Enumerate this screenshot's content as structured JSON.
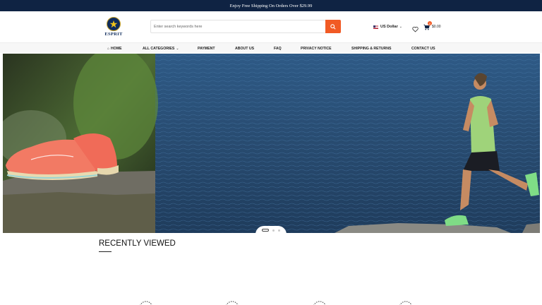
{
  "announcement": "Enjoy Free Shipping On Orders Over $29.99",
  "brand": {
    "name": "ESPRIT",
    "icon": "star-badge-icon"
  },
  "search": {
    "placeholder": "Enter search keywords here",
    "button_icon": "search-icon"
  },
  "currency": {
    "label": "US Dollar",
    "flag_icon": "us-flag-icon"
  },
  "wishlist": {
    "icon": "heart-icon"
  },
  "cart": {
    "count": "0",
    "total": "$0.00",
    "icon": "cart-icon"
  },
  "nav": {
    "home": "HOME",
    "categories": "ALL CATEGORIES",
    "payment": "PAYMENT",
    "about": "ABOUT US",
    "faq": "FAQ",
    "privacy": "PRIVACY NOTICE",
    "shipping": "SHIPPING & RETURNS",
    "contact": "CONTACT US"
  },
  "hero": {
    "active_slide": 1,
    "slide_count": 3
  },
  "recently_viewed": {
    "title": "RECENTLY VIEWED"
  },
  "colors": {
    "topbar": "#0f2343",
    "accent": "#f15a24",
    "brand": "#0f2c5c"
  }
}
